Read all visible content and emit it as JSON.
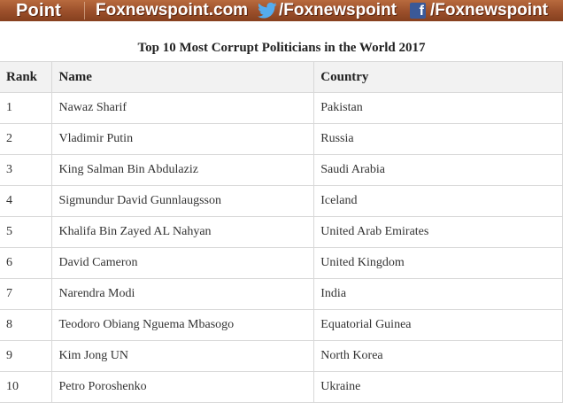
{
  "banner": {
    "brand_fragment": "Point",
    "site": "Foxnewspoint.com",
    "twitter_handle": "/Foxnewspoint",
    "facebook_glyph": "f",
    "facebook_handle": "/Foxnewspoint",
    "icons": [
      "twitter-bird-icon",
      "facebook-icon"
    ],
    "colors": {
      "banner_bg": "#9a4f2a",
      "twitter_blue": "#55acee",
      "facebook_blue": "#3b5998"
    }
  },
  "title": "Top 10 Most Corrupt Politicians in the World 2017",
  "table": {
    "headers": {
      "rank": "Rank",
      "name": "Name",
      "country": "Country"
    },
    "rows": [
      {
        "rank": "1",
        "name": "Nawaz Sharif",
        "country": "Pakistan"
      },
      {
        "rank": "2",
        "name": "Vladimir Putin",
        "country": "Russia"
      },
      {
        "rank": "3",
        "name": "King Salman Bin Abdulaziz",
        "country": "Saudi Arabia"
      },
      {
        "rank": "4",
        "name": "Sigmundur David Gunnlaugsson",
        "country": "Iceland"
      },
      {
        "rank": "5",
        "name": "Khalifa Bin Zayed AL Nahyan",
        "country": "United Arab Emirates"
      },
      {
        "rank": "6",
        "name": "David Cameron",
        "country": "United Kingdom"
      },
      {
        "rank": "7",
        "name": "Narendra Modi",
        "country": "India"
      },
      {
        "rank": "8",
        "name": "Teodoro Obiang Nguema Mbasogo",
        "country": "Equatorial Guinea"
      },
      {
        "rank": "9",
        "name": "Kim Jong UN",
        "country": "North Korea"
      },
      {
        "rank": "10",
        "name": "Petro Poroshenko",
        "country": "Ukraine"
      }
    ]
  }
}
